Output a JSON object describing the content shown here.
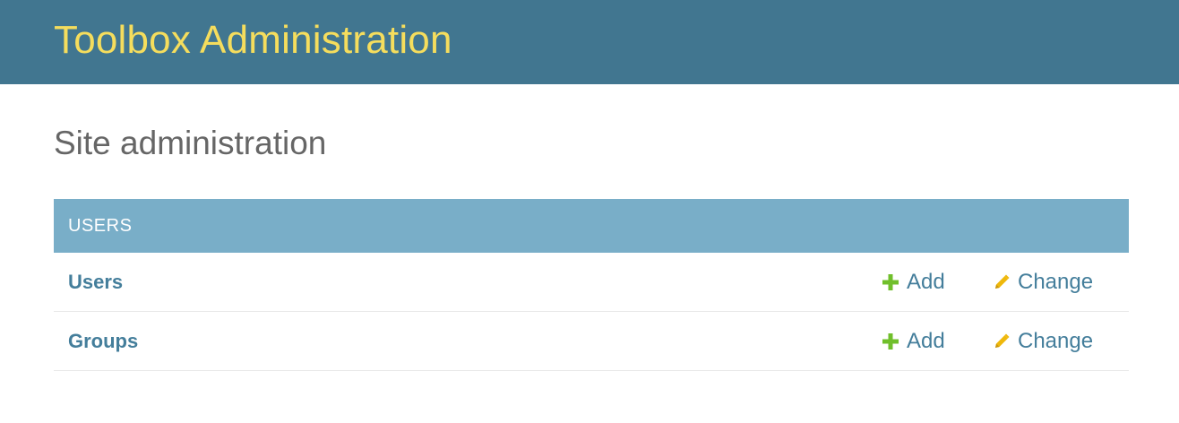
{
  "header": {
    "site_title": "Toolbox Administration"
  },
  "main": {
    "page_title": "Site administration",
    "modules": [
      {
        "caption": "USERS",
        "rows": [
          {
            "label": "Users",
            "add_label": "Add",
            "change_label": "Change"
          },
          {
            "label": "Groups",
            "add_label": "Add",
            "change_label": "Change"
          }
        ]
      }
    ]
  },
  "colors": {
    "header_bg": "#417690",
    "site_title": "#f5dd5d",
    "caption_bg": "#79aec8",
    "link": "#447e9b",
    "add_icon": "#70bf2b",
    "change_icon": "#efb80b"
  },
  "icons": {
    "add": "plus-icon",
    "change": "pencil-icon"
  }
}
